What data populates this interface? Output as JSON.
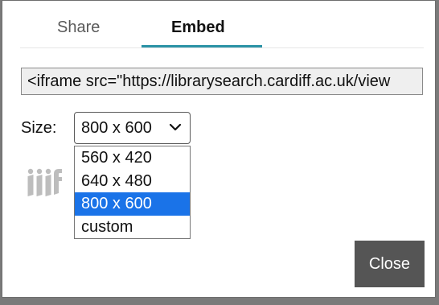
{
  "tabs": [
    {
      "label": "Share",
      "active": false
    },
    {
      "label": "Embed",
      "active": true
    }
  ],
  "embed": {
    "code_value": "<iframe src=\"https://librarysearch.cardiff.ac.uk/view",
    "size_label": "Size:",
    "size_selected": "800 x 600",
    "size_options": [
      "560 x 420",
      "640 x 480",
      "800 x 600",
      "custom"
    ]
  },
  "logo": {
    "name": "iiif-logo",
    "color": "#bdbdbd"
  },
  "close_label": "Close",
  "colors": {
    "accent": "#2a92a6",
    "option_highlight": "#1a73e8",
    "close_button": "#555555"
  },
  "icons": {
    "select_arrow": "chevron-down-icon"
  }
}
